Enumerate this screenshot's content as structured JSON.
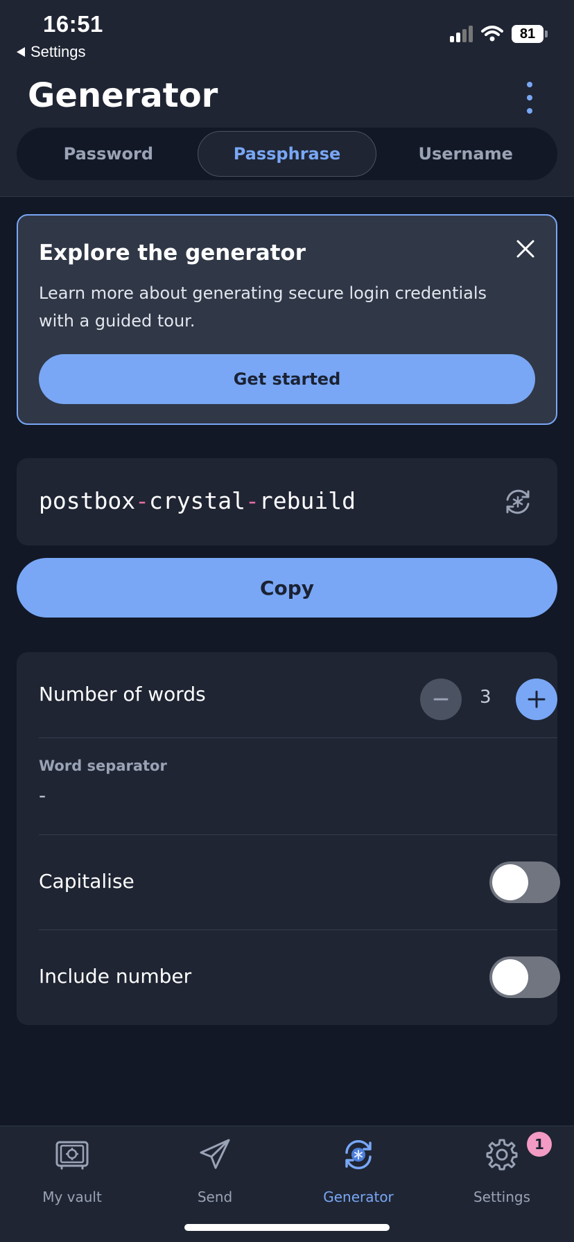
{
  "status_bar": {
    "time": "16:51",
    "back_label": "Settings",
    "battery": "81"
  },
  "header": {
    "title": "Generator"
  },
  "tabs": [
    {
      "label": "Password"
    },
    {
      "label": "Passphrase"
    },
    {
      "label": "Username"
    }
  ],
  "explore": {
    "title": "Explore the generator",
    "text": "Learn more about generating secure login credentials with a guided tour.",
    "button": "Get started"
  },
  "passphrase": {
    "word1": "postbox",
    "word2": "crystal",
    "word3": "rebuild",
    "sep": "-"
  },
  "copy_button": "Copy",
  "options": {
    "words_label": "Number of words",
    "words_value": "3",
    "separator_label": "Word separator",
    "separator_value": "-",
    "capitalise_label": "Capitalise",
    "include_number_label": "Include number"
  },
  "tabbar": [
    {
      "label": "My vault",
      "icon": "vault-icon"
    },
    {
      "label": "Send",
      "icon": "send-icon"
    },
    {
      "label": "Generator",
      "icon": "generator-icon"
    },
    {
      "label": "Settings",
      "icon": "gear-icon",
      "badge": "1"
    }
  ],
  "colors": {
    "accent": "#79a7f5",
    "background": "#121826",
    "surface": "#1f2533",
    "separator_highlight": "#e06c9f",
    "badge": "#f39bc4"
  }
}
